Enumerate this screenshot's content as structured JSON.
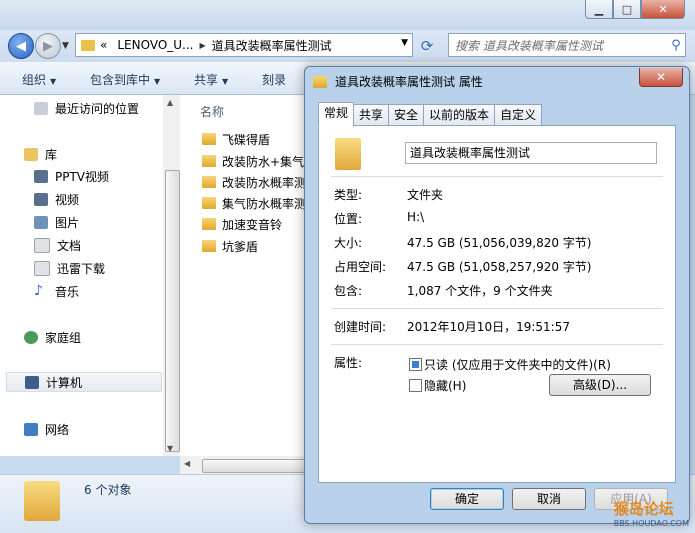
{
  "explorer": {
    "window_controls": {
      "minimize": "▁",
      "maximize": "□",
      "close": "✕"
    },
    "address": {
      "crumbs": [
        "«",
        "LENOVO_U...",
        "道具改装概率属性测试"
      ]
    },
    "search_placeholder": "搜索 道具改装概率属性测试",
    "toolbar": {
      "organize": "组织",
      "include_in_library": "包含到库中",
      "share": "共享",
      "burn": "刻录"
    },
    "nav_items": [
      {
        "label": "最近访问的位置",
        "icon": "recent-places-icon"
      },
      {
        "label": "库",
        "icon": "library-icon"
      },
      {
        "label": "PPTV视频",
        "icon": "video-library-icon"
      },
      {
        "label": "视频",
        "icon": "video-library-icon"
      },
      {
        "label": "图片",
        "icon": "pictures-icon"
      },
      {
        "label": "文档",
        "icon": "documents-icon"
      },
      {
        "label": "迅雷下载",
        "icon": "download-icon"
      },
      {
        "label": "音乐",
        "icon": "music-icon"
      },
      {
        "label": "家庭组",
        "icon": "homegroup-icon"
      },
      {
        "label": "计算机",
        "icon": "computer-icon"
      },
      {
        "label": "网络",
        "icon": "network-icon"
      }
    ],
    "column_header": "名称",
    "files": [
      "飞碟得盾",
      "改装防水+集气",
      "改装防水概率测",
      "集气防水概率测",
      "加速变音铃",
      "坑爹盾"
    ],
    "status": "6 个对象"
  },
  "dialog": {
    "title": "道具改装概率属性测试 属性",
    "close": "✕",
    "tabs": [
      "常规",
      "共享",
      "安全",
      "以前的版本",
      "自定义"
    ],
    "active_tab": "常规",
    "name_value": "道具改装概率属性测试",
    "rows": [
      {
        "label": "类型:",
        "value": "文件夹"
      },
      {
        "label": "位置:",
        "value": "H:\\"
      },
      {
        "label": "大小:",
        "value": "47.5 GB (51,056,039,820 字节)"
      },
      {
        "label": "占用空间:",
        "value": "47.5 GB (51,058,257,920 字节)"
      },
      {
        "label": "包含:",
        "value": "1,087 个文件，9 个文件夹"
      },
      {
        "label": "创建时间:",
        "value": "2012年10月10日，19:51:57"
      }
    ],
    "attributes_label": "属性:",
    "readonly_label": "只读 (仅应用于文件夹中的文件)(R)",
    "hidden_label": "隐藏(H)",
    "advanced_button": "高级(D)...",
    "ok_button": "确定",
    "cancel_button": "取消",
    "apply_button": "应用(A)"
  },
  "watermark": {
    "text": "猴岛论坛",
    "url_text": "BBS.HOUDAO.COM"
  },
  "colors": {
    "folder": "#e9c04a",
    "accent": "#3a7fd0",
    "close": "#c8523a"
  }
}
